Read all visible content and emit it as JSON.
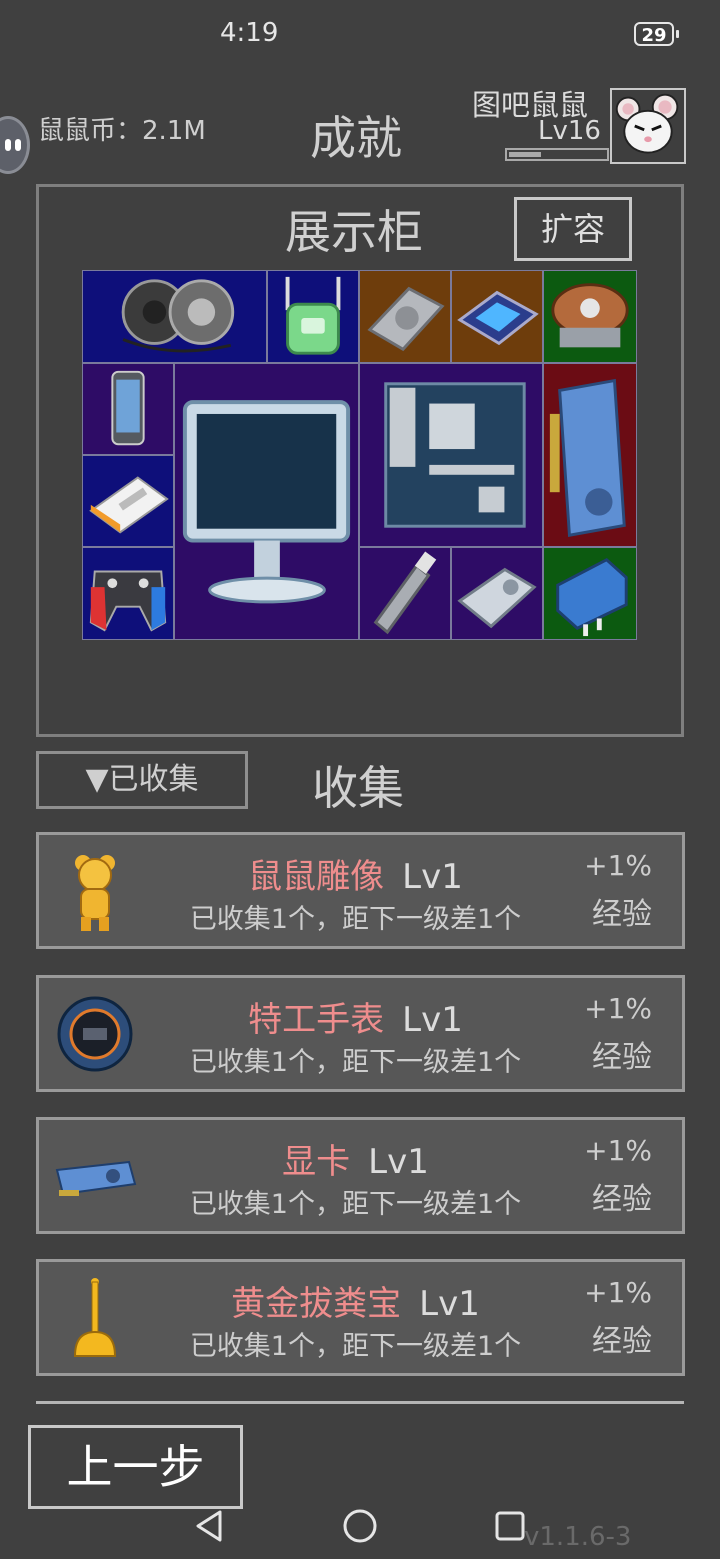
{
  "status_bar": {
    "time": "4:19",
    "battery": "29"
  },
  "header": {
    "coins_label": "鼠鼠币：",
    "coins_value": "2.1M",
    "title": "成就",
    "username": "图吧鼠鼠",
    "level": "Lv16",
    "xp_fraction": 0.33
  },
  "cabinet": {
    "title": "展示柜",
    "expand_label": "扩容",
    "items": [
      "speakers",
      "router",
      "hard-drive",
      "cpu",
      "cpu-cooler",
      "phone",
      "monitor",
      "motherboard",
      "graphics-card",
      "power-bank",
      "gamepad",
      "usb-drive",
      "ssd",
      "power-adapter"
    ],
    "colors": {
      "blue": "#0e0f7a",
      "purple": "#2e0c66",
      "brown": "#6e3d0c",
      "green": "#0c5a10",
      "red": "#6b0c14"
    }
  },
  "collection": {
    "filter_label": "▼已收集",
    "title": "收集",
    "items": [
      {
        "icon": "bear-statue-icon",
        "name": "鼠鼠雕像",
        "level": "Lv1",
        "desc": "已收集1个，距下一级差1个",
        "bonus": "+1%",
        "bonus_type": "经验"
      },
      {
        "icon": "watch-icon",
        "name": "特工手表",
        "level": "Lv1",
        "desc": "已收集1个，距下一级差1个",
        "bonus": "+1%",
        "bonus_type": "经验"
      },
      {
        "icon": "graphics-card-icon",
        "name": "显卡",
        "level": "Lv1",
        "desc": "已收集1个，距下一级差1个",
        "bonus": "+1%",
        "bonus_type": "经验"
      },
      {
        "icon": "golden-plunger-icon",
        "name": "黄金拔粪宝",
        "level": "Lv1",
        "desc": "已收集1个，距下一级差1个",
        "bonus": "+1%",
        "bonus_type": "经验"
      }
    ]
  },
  "footer": {
    "back_label": "上一步",
    "version": "v1.1.6-3"
  },
  "nav": {
    "back": "back-icon",
    "home": "home-icon",
    "recents": "recents-icon"
  }
}
